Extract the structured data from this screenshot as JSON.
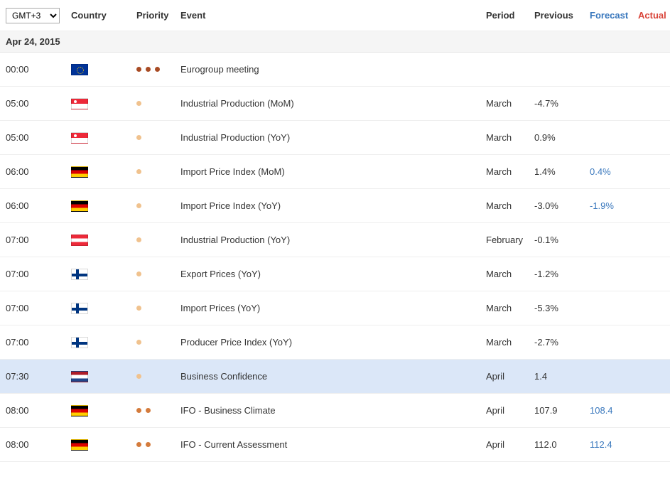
{
  "timezone": {
    "selected": "GMT+3"
  },
  "headers": {
    "country": "Country",
    "priority": "Priority",
    "event": "Event",
    "period": "Period",
    "previous": "Previous",
    "forecast": "Forecast",
    "actual": "Actual"
  },
  "date_label": "Apr 24, 2015",
  "rows": [
    {
      "time": "00:00",
      "flag": "eu",
      "flag_name": "eu-flag-icon",
      "priority": 3,
      "event": "Eurogroup meeting",
      "period": "",
      "previous": "",
      "forecast": "",
      "actual": "",
      "highlight": false
    },
    {
      "time": "05:00",
      "flag": "sg",
      "flag_name": "singapore-flag-icon",
      "priority": 1,
      "event": "Industrial Production (MoM)",
      "period": "March",
      "previous": "-4.7%",
      "forecast": "",
      "actual": "",
      "highlight": false
    },
    {
      "time": "05:00",
      "flag": "sg",
      "flag_name": "singapore-flag-icon",
      "priority": 1,
      "event": "Industrial Production (YoY)",
      "period": "March",
      "previous": "0.9%",
      "forecast": "",
      "actual": "",
      "highlight": false
    },
    {
      "time": "06:00",
      "flag": "de",
      "flag_name": "germany-flag-icon",
      "priority": 1,
      "event": "Import Price Index (MoM)",
      "period": "March",
      "previous": "1.4%",
      "forecast": "0.4%",
      "actual": "",
      "highlight": false
    },
    {
      "time": "06:00",
      "flag": "de",
      "flag_name": "germany-flag-icon",
      "priority": 1,
      "event": "Import Price Index (YoY)",
      "period": "March",
      "previous": "-3.0%",
      "forecast": "-1.9%",
      "actual": "",
      "highlight": false
    },
    {
      "time": "07:00",
      "flag": "at",
      "flag_name": "austria-flag-icon",
      "priority": 1,
      "event": "Industrial Production (YoY)",
      "period": "February",
      "previous": "-0.1%",
      "forecast": "",
      "actual": "",
      "highlight": false
    },
    {
      "time": "07:00",
      "flag": "fi",
      "flag_name": "finland-flag-icon",
      "priority": 1,
      "event": "Export Prices (YoY)",
      "period": "March",
      "previous": "-1.2%",
      "forecast": "",
      "actual": "",
      "highlight": false
    },
    {
      "time": "07:00",
      "flag": "fi",
      "flag_name": "finland-flag-icon",
      "priority": 1,
      "event": "Import Prices (YoY)",
      "period": "March",
      "previous": "-5.3%",
      "forecast": "",
      "actual": "",
      "highlight": false
    },
    {
      "time": "07:00",
      "flag": "fi",
      "flag_name": "finland-flag-icon",
      "priority": 1,
      "event": "Producer Price Index (YoY)",
      "period": "March",
      "previous": "-2.7%",
      "forecast": "",
      "actual": "",
      "highlight": false
    },
    {
      "time": "07:30",
      "flag": "nl",
      "flag_name": "netherlands-flag-icon",
      "priority": 1,
      "event": "Business Confidence",
      "period": "April",
      "previous": "1.4",
      "forecast": "",
      "actual": "",
      "highlight": true
    },
    {
      "time": "08:00",
      "flag": "de",
      "flag_name": "germany-flag-icon",
      "priority": 2,
      "event": "IFO - Business Climate",
      "period": "April",
      "previous": "107.9",
      "forecast": "108.4",
      "actual": "",
      "highlight": false
    },
    {
      "time": "08:00",
      "flag": "de",
      "flag_name": "germany-flag-icon",
      "priority": 2,
      "event": "IFO - Current Assessment",
      "period": "April",
      "previous": "112.0",
      "forecast": "112.4",
      "actual": "",
      "highlight": false
    }
  ]
}
